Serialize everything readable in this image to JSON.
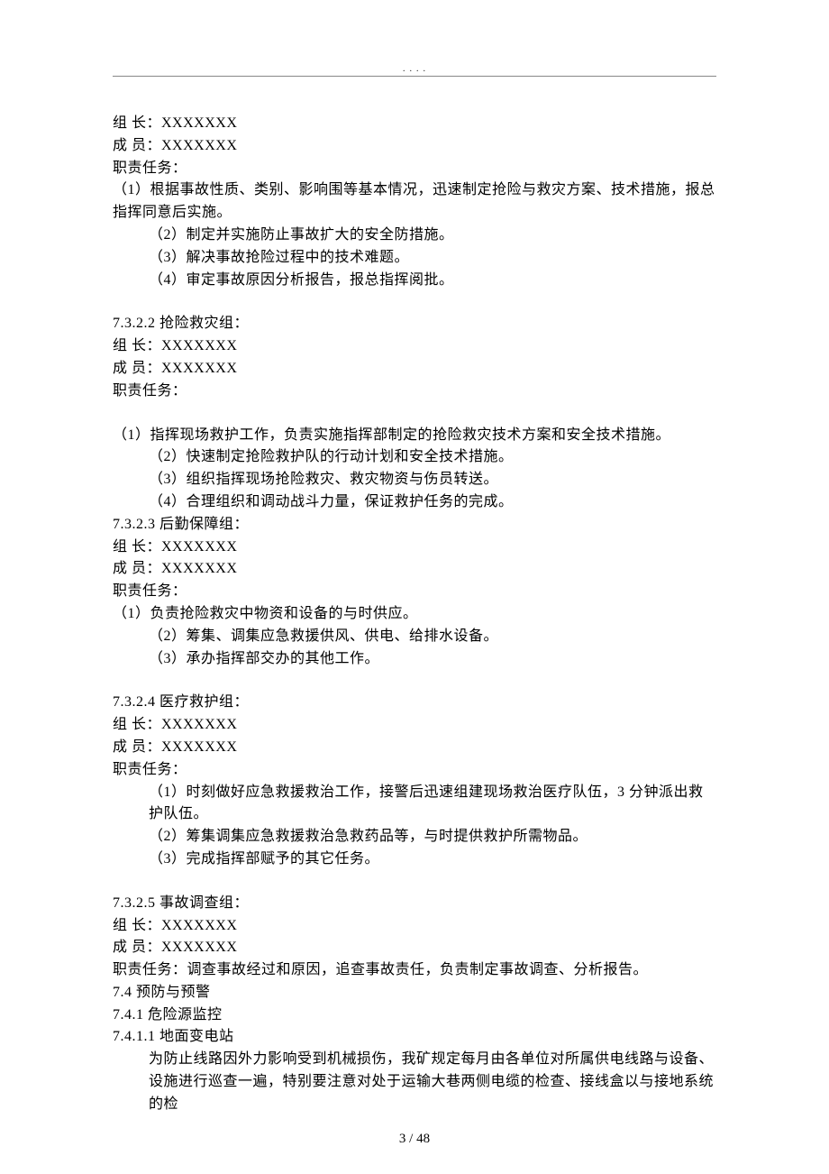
{
  "header": {
    "dots": ".        .                .            ."
  },
  "s1": {
    "leader": "组 长：XXXXXXX",
    "members": "成 员：XXXXXXX",
    "dutyLabel": "职责任务：",
    "d1": "（1）根据事故性质、类别、影响围等基本情况，迅速制定抢险与救灾方案、技术措施，报总指挥同意后实施。",
    "d2": "（2）制定并实施防止事故扩大的安全防措施。",
    "d3": "（3）解决事故抢险过程中的技术难题。",
    "d4": "（4）审定事故原因分析报告，报总指挥阅批。"
  },
  "s2": {
    "title": "7.3.2.2 抢险救灾组：",
    "leader": "组 长：XXXXXXX",
    "members": "成 员：XXXXXXX",
    "dutyLabel": "职责任务：",
    "d1": "（1）指挥现场救护工作，负责实施指挥部制定的抢险救灾技术方案和安全技术措施。",
    "d2": "（2）快速制定抢险救护队的行动计划和安全技术措施。",
    "d3": "（3）组织指挥现场抢险救灾、救灾物资与伤员转送。",
    "d4": "（4）合理组织和调动战斗力量，保证救护任务的完成。"
  },
  "s3": {
    "title": "7.3.2.3 后勤保障组：",
    "leader": "组 长：XXXXXXX",
    "members": "成 员：XXXXXXX",
    "dutyLabel": "职责任务：",
    "d1": "（1）负责抢险救灾中物资和设备的与时供应。",
    "d2": "（2）筹集、调集应急救援供风、供电、给排水设备。",
    "d3": "（3）承办指挥部交办的其他工作。"
  },
  "s4": {
    "title": "7.3.2.4 医疗救护组：",
    "leader": "组 长：XXXXXXX",
    "members": "成 员：XXXXXXX",
    "dutyLabel": "职责任务：",
    "d1": "（1）时刻做好应急救援救治工作，接警后迅速组建现场救治医疗队伍，3 分钟派出救护队伍。",
    "d2": "（2）筹集调集应急救援救治急救药品等，与时提供救护所需物品。",
    "d3": "（3）完成指挥部赋予的其它任务。"
  },
  "s5": {
    "title": "7.3.2.5 事故调查组：",
    "leader": "组 长：XXXXXXX",
    "members": "成 员：XXXXXXX",
    "dutyLine": "职责任务：调查事故经过和原因，追查事故责任，负责制定事故调查、分析报告。"
  },
  "s6": {
    "h1": "7.4 预防与预警",
    "h2": "7.4.1 危险源监控",
    "h3": "7.4.1.1 地面变电站",
    "p1": "为防止线路因外力影响受到机械损伤，我矿规定每月由各单位对所属供电线路与设备、设施进行巡查一遍，特别要注意对处于运输大巷两侧电缆的检查、接线盒以与接地系统的检"
  },
  "footer": {
    "pagination": "3 / 48"
  }
}
